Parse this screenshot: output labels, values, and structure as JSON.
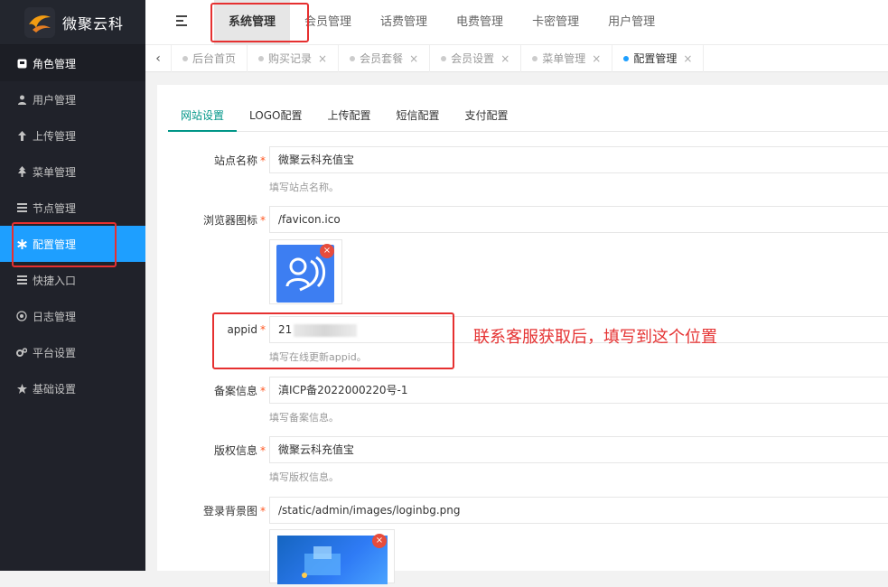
{
  "sidebar": {
    "logo_text": "微聚云科",
    "items": [
      {
        "label": "角色管理",
        "icon": "role-icon"
      },
      {
        "label": "用户管理",
        "icon": "user-icon"
      },
      {
        "label": "上传管理",
        "icon": "upload-arrow-icon"
      },
      {
        "label": "菜单管理",
        "icon": "tree-icon"
      },
      {
        "label": "节点管理",
        "icon": "list-icon"
      },
      {
        "label": "配置管理",
        "icon": "asterisk-icon"
      },
      {
        "label": "快捷入口",
        "icon": "list-icon"
      },
      {
        "label": "日志管理",
        "icon": "log-icon"
      },
      {
        "label": "平台设置",
        "icon": "gears-icon"
      },
      {
        "label": "基础设置",
        "icon": "star-icon"
      }
    ]
  },
  "topnav": {
    "items": [
      "系统管理",
      "会员管理",
      "话费管理",
      "电费管理",
      "卡密管理",
      "用户管理"
    ]
  },
  "tabs": [
    "后台首页",
    "购买记录",
    "会员套餐",
    "会员设置",
    "菜单管理",
    "配置管理"
  ],
  "subtabs": [
    "网站设置",
    "LOGO配置",
    "上传配置",
    "短信配置",
    "支付配置"
  ],
  "form": {
    "site_name": {
      "label": "站点名称",
      "value": "微聚云科充值宝",
      "hint": "填写站点名称。"
    },
    "favicon": {
      "label": "浏览器图标",
      "value": "/favicon.ico"
    },
    "appid": {
      "label": "appid",
      "value": "21",
      "hint": "填写在线更新appid。"
    },
    "icp": {
      "label": "备案信息",
      "value": "滇ICP备2022000220号-1",
      "hint": "填写备案信息。"
    },
    "copyright": {
      "label": "版权信息",
      "value": "微聚云科充值宝",
      "hint": "填写版权信息。"
    },
    "login_bg": {
      "label": "登录背景图",
      "value": "/static/admin/images/loginbg.png"
    }
  },
  "delete_glyph": "×",
  "required_mark": "*",
  "annotation": "联系客服获取后，填写到这个位置",
  "colors": {
    "accent": "#1e9fff",
    "highlight": "#e63030",
    "tab_active": "#009688",
    "sidebar_bg": "#20222a"
  }
}
